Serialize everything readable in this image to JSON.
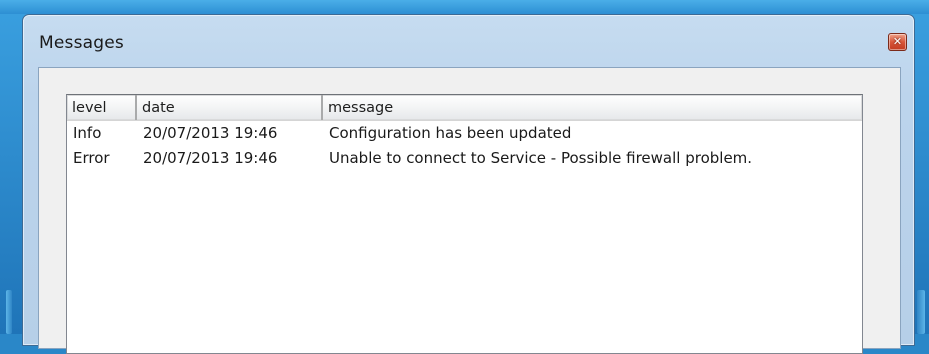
{
  "window": {
    "title": "Messages",
    "close_icon": "close-icon"
  },
  "list": {
    "columns": [
      {
        "label": "level"
      },
      {
        "label": "date"
      },
      {
        "label": "message"
      }
    ],
    "rows": [
      {
        "level": "Info",
        "date": "20/07/2013 19:46",
        "message": "Configuration has been updated"
      },
      {
        "level": "Error",
        "date": "20/07/2013 19:46",
        "message": "Unable to connect to Service - Possible firewall problem."
      }
    ]
  }
}
